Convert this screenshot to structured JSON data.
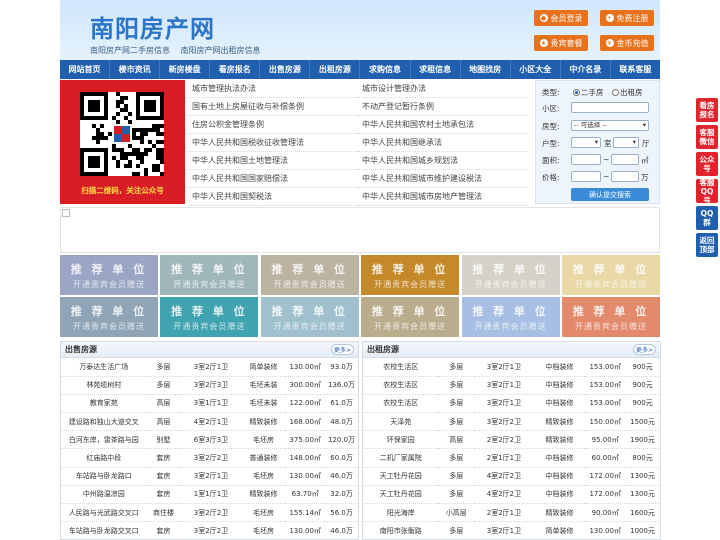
{
  "header": {
    "logo": "南阳房产网",
    "taglines": [
      "南阳房产网二手房信息",
      "南阳房产网出租房信息"
    ],
    "buttons": [
      {
        "label": "会员登录",
        "icon": "user-icon"
      },
      {
        "label": "免费注册",
        "icon": "register-icon"
      },
      {
        "label": "贵宾套餐",
        "icon": "vip-icon"
      },
      {
        "label": "金币充值",
        "icon": "coin-icon"
      }
    ]
  },
  "nav": [
    "网站首页",
    "楼市资讯",
    "新房楼盘",
    "看房报名",
    "出售房源",
    "出租房源",
    "求购信息",
    "求租信息",
    "地图找房",
    "小区大全",
    "中介名录",
    "联系客服"
  ],
  "qr": {
    "caption": "扫描二维码，关注公众号"
  },
  "links": [
    "城市管理执法办法",
    "城市设计管理办法",
    "国有土地上房屋征收与补偿条例",
    "不动产登记暂行条例",
    "住房公积金管理条例",
    "中华人民共和国农村土地承包法",
    "中华人民共和国税收征收管理法",
    "中华人民共和国继承法",
    "中华人民共和国土地管理法",
    "中华人民共和国城乡规划法",
    "中华人民共和国国家赔偿法",
    "中华人民共和国城市维护建设税法",
    "中华人民共和国契税法",
    "中华人民共和国城市房地产管理法"
  ],
  "search": {
    "type_label": "类型:",
    "type_opt1": "二手房",
    "type_opt2": "出租房",
    "district_label": "小区:",
    "house_label": "房型:",
    "house_select": "-- 可选择 --",
    "layout_label": "户型:",
    "room_unit": "室",
    "hall_unit": "厅",
    "area_label": "面积:",
    "area_unit": "㎡",
    "price_label": "价格:",
    "price_unit": "万",
    "tilde": "~",
    "submit": "确认提交搜索"
  },
  "ads": {
    "title": "推 荐 单 位",
    "subtitle": "开通贵宾会员赠送",
    "colors": [
      "#9aa6c4",
      "#9fb7bb",
      "#bcb3a3",
      "#c48a2a",
      "#d5d1c6",
      "#e8d9a7",
      "#8fa4b5",
      "#3fa3b0",
      "#9fc0cc",
      "#b9ad8e",
      "#a7bfe3",
      "#e38a6c"
    ]
  },
  "sale": {
    "title": "出售房源",
    "more": "更多>",
    "rows": [
      [
        "万泰达生活广场",
        "多层",
        "3室2厅1卫",
        "简单装修",
        "130.00㎡",
        "93.0万"
      ],
      [
        "林苑缆树村",
        "多层",
        "3室2厅3卫",
        "毛坯未装",
        "300.00㎡",
        "136.0万"
      ],
      [
        "教育家苑",
        "高层",
        "3室1厅1卫",
        "毛坯未装",
        "122.00㎡",
        "61.0万"
      ],
      [
        "建设路和独山大道交叉",
        "高层",
        "4室2厅1卫",
        "精致装修",
        "168.00㎡",
        "48.0万"
      ],
      [
        "白河东岸，雷茶路与园",
        "别墅",
        "6室3厅3卫",
        "毛坯房",
        "375.00㎡",
        "120.0万"
      ],
      [
        "红庙路中段",
        "套房",
        "3室2厅2卫",
        "普通装修",
        "148.00㎡",
        "60.0万"
      ],
      [
        "车站路与卧龙路口",
        "套房",
        "3室2厅1卫",
        "毛坯房",
        "130.00㎡",
        "46.0万"
      ],
      [
        "中州路温凉园",
        "套房",
        "1室1厅1卫",
        "精致装修",
        "63.70㎡",
        "32.0万"
      ],
      [
        "人民路与光武路交叉口",
        "商住楼",
        "3室2厅2卫",
        "毛坯房",
        "155.14㎡",
        "56.0万"
      ],
      [
        "车站路与卧龙路交叉口",
        "套房",
        "3室2厅2卫",
        "毛坯房",
        "130.00㎡",
        "46.0万"
      ]
    ]
  },
  "rent": {
    "title": "出租房源",
    "more": "更多>",
    "rows": [
      [
        "农校生活区",
        "多层",
        "3室2厅1卫",
        "中档装修",
        "153.00㎡",
        "900元"
      ],
      [
        "农校生活区",
        "多层",
        "3室2厅1卫",
        "中档装修",
        "153.00㎡",
        "900元"
      ],
      [
        "农校生活区",
        "多层",
        "3室2厅1卫",
        "中档装修",
        "153.00㎡",
        "900元"
      ],
      [
        "天泽苑",
        "多层",
        "3室2厅2卫",
        "精致装修",
        "150.00㎡",
        "1500元"
      ],
      [
        "环保家园",
        "高层",
        "2室2厅2卫",
        "精致装修",
        "95.00㎡",
        "1900元"
      ],
      [
        "二机厂家属院",
        "多层",
        "2室1厅1卫",
        "中档装修",
        "60.00㎡",
        "800元"
      ],
      [
        "天工牡丹花园",
        "多层",
        "4室2厅2卫",
        "中档装修",
        "172.00㎡",
        "1300元"
      ],
      [
        "天工牡丹花园",
        "多层",
        "4室2厅2卫",
        "中档装修",
        "172.00㎡",
        "1300元"
      ],
      [
        "阳光海岸",
        "小高层",
        "2室2厅1卫",
        "精致装修",
        "90.00㎡",
        "1600元"
      ],
      [
        "南阳市张衡路",
        "多层",
        "3室2厅1卫",
        "简单装修",
        "130.00㎡",
        "1000元"
      ]
    ]
  },
  "side": [
    {
      "label": "看房报名",
      "color": "#e0242b"
    },
    {
      "label": "客服微信",
      "color": "#e0242b"
    },
    {
      "label": "公众号",
      "color": "#e0242b"
    },
    {
      "label": "客服QQ号",
      "color": "#e0242b"
    },
    {
      "label": "QQ群",
      "color": "#1f5fae"
    },
    {
      "label": "返回顶部",
      "color": "#1f5fae"
    }
  ]
}
